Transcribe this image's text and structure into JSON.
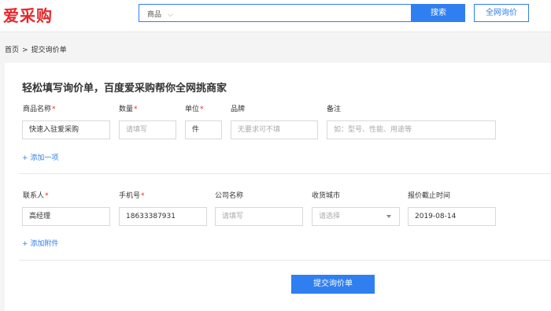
{
  "header": {
    "logo": "爱采购",
    "search_category": "商品",
    "search_button": "搜索",
    "all_inquiry_button": "全网询价"
  },
  "breadcrumb": {
    "home": "首页",
    "sep": ">",
    "current": "提交询价单"
  },
  "form": {
    "heading": "轻松填写询价单，百度爱采购帮你全网挑商家",
    "product_row": {
      "labels": {
        "name": "商品名称",
        "qty": "数量",
        "unit": "单位",
        "brand": "品牌",
        "note": "备注"
      },
      "required_mark": "*",
      "values": {
        "name": "快速入驻爱采购",
        "unit": "件"
      },
      "placeholders": {
        "qty": "请填写",
        "brand": "无要求可不填",
        "note": "如：型号、性能、用途等"
      }
    },
    "add_item": "+ 添加一项",
    "contact_row": {
      "labels": {
        "contact": "联系人",
        "phone": "手机号",
        "company": "公司名称",
        "city": "收货城市",
        "deadline": "报价截止时间"
      },
      "values": {
        "contact": "高经理",
        "phone": "18633387931",
        "deadline": "2019-08-14"
      },
      "placeholders": {
        "company": "请填写",
        "city": "请选择"
      }
    },
    "add_attachment": "+ 添加附件",
    "submit": "提交询价单"
  },
  "colors": {
    "accent": "#2f7ff0",
    "brand": "#e8262b"
  }
}
